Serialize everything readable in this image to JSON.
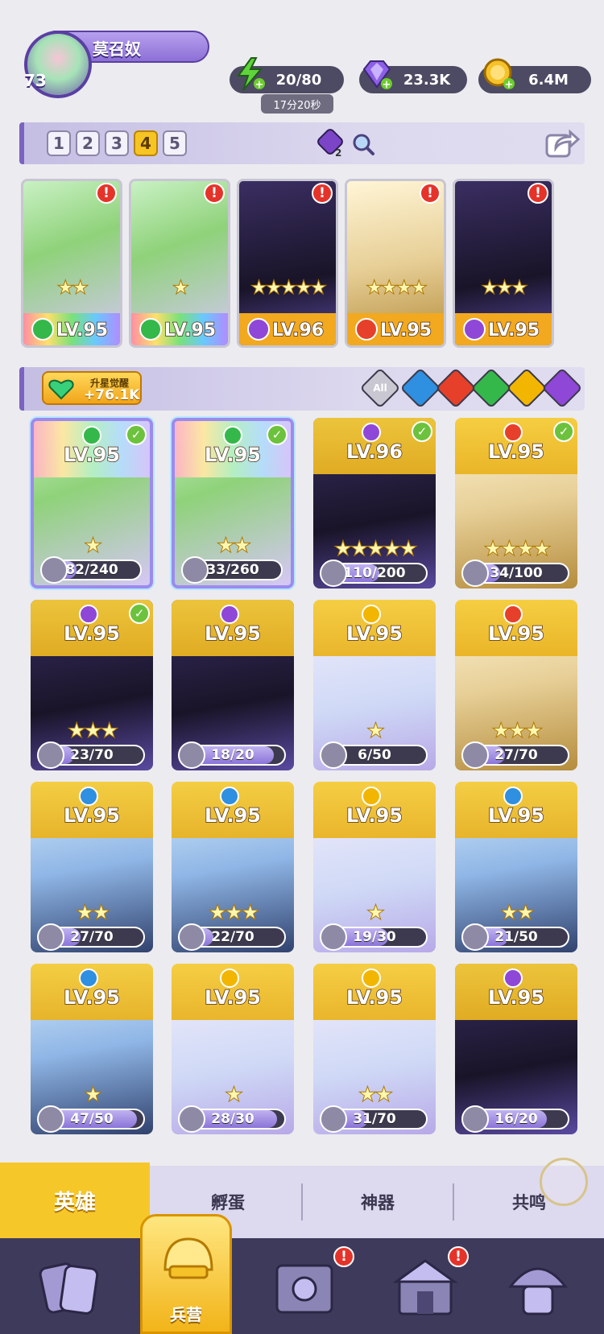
{
  "player": {
    "level": "73",
    "name": "莫召奴"
  },
  "resources": {
    "energy": "20/80",
    "energy_timer": "17分20秒",
    "gems": "23.3K",
    "gold": "6.4M"
  },
  "team": {
    "tabs": [
      "1",
      "2",
      "3",
      "4",
      "5"
    ],
    "active_tab": "4",
    "count_badge": "2",
    "slots": [
      {
        "level": "LV.95",
        "element": "nature",
        "stars": 2,
        "badge": "!"
      },
      {
        "level": "LV.95",
        "element": "nature",
        "stars": 1,
        "badge": "!"
      },
      {
        "level": "LV.96",
        "element": "dark",
        "stars": 5,
        "badge": "!"
      },
      {
        "level": "LV.95",
        "element": "fire",
        "stars": 4,
        "badge": "!"
      },
      {
        "level": "LV.95",
        "element": "dark",
        "stars": 3,
        "badge": "!"
      }
    ]
  },
  "filter": {
    "awaken_title": "升星觉醒",
    "awaken_value": "+76.1K",
    "all_label": "All",
    "elements": [
      "water",
      "fire",
      "nature",
      "light",
      "dark"
    ]
  },
  "heroes": [
    {
      "level": "LV.95",
      "element": "nature",
      "shards": "82/240",
      "progress": 0.34,
      "check": true,
      "stars": 1
    },
    {
      "level": "LV.95",
      "element": "nature",
      "shards": "33/260",
      "progress": 0.13,
      "check": true,
      "stars": 2
    },
    {
      "level": "LV.96",
      "element": "dark",
      "shards": "110/200",
      "progress": 0.55,
      "check": true,
      "stars": 5
    },
    {
      "level": "LV.95",
      "element": "fire",
      "shards": "34/100",
      "progress": 0.34,
      "check": true,
      "stars": 4
    },
    {
      "level": "LV.95",
      "element": "dark",
      "shards": "23/70",
      "progress": 0.33,
      "check": true,
      "stars": 3
    },
    {
      "level": "LV.95",
      "element": "dark",
      "shards": "18/20",
      "progress": 0.9,
      "check": false,
      "stars": 0
    },
    {
      "level": "LV.95",
      "element": "light",
      "shards": "6/50",
      "progress": 0.12,
      "check": false,
      "stars": 1
    },
    {
      "level": "LV.95",
      "element": "fire",
      "shards": "27/70",
      "progress": 0.39,
      "check": false,
      "stars": 3
    },
    {
      "level": "LV.95",
      "element": "water",
      "shards": "27/70",
      "progress": 0.39,
      "check": false,
      "stars": 2
    },
    {
      "level": "LV.95",
      "element": "water",
      "shards": "22/70",
      "progress": 0.31,
      "check": false,
      "stars": 3
    },
    {
      "level": "LV.95",
      "element": "light",
      "shards": "19/30",
      "progress": 0.63,
      "check": false,
      "stars": 1
    },
    {
      "level": "LV.95",
      "element": "water",
      "shards": "21/50",
      "progress": 0.42,
      "check": false,
      "stars": 2
    },
    {
      "level": "LV.95",
      "element": "water",
      "shards": "47/50",
      "progress": 0.94,
      "check": false,
      "stars": 1
    },
    {
      "level": "LV.95",
      "element": "light",
      "shards": "28/30",
      "progress": 0.93,
      "check": false,
      "stars": 1
    },
    {
      "level": "LV.95",
      "element": "light",
      "shards": "31/70",
      "progress": 0.44,
      "check": false,
      "stars": 2
    },
    {
      "level": "LV.95",
      "element": "dark",
      "shards": "16/20",
      "progress": 0.8,
      "check": false,
      "stars": 0
    }
  ],
  "tabs": {
    "heroes": "英雄",
    "hatch": "孵蛋",
    "artifacts": "神器",
    "resonance": "共鸣"
  },
  "nav": {
    "barracks": "兵营",
    "badge": "!"
  },
  "colors": {
    "accent": "#7a63c2",
    "gold": "#f6c729",
    "nature": "#35b84a",
    "dark": "#8f47d8",
    "fire": "#e6402a",
    "light": "#f2b600",
    "water": "#2f8fe0"
  }
}
